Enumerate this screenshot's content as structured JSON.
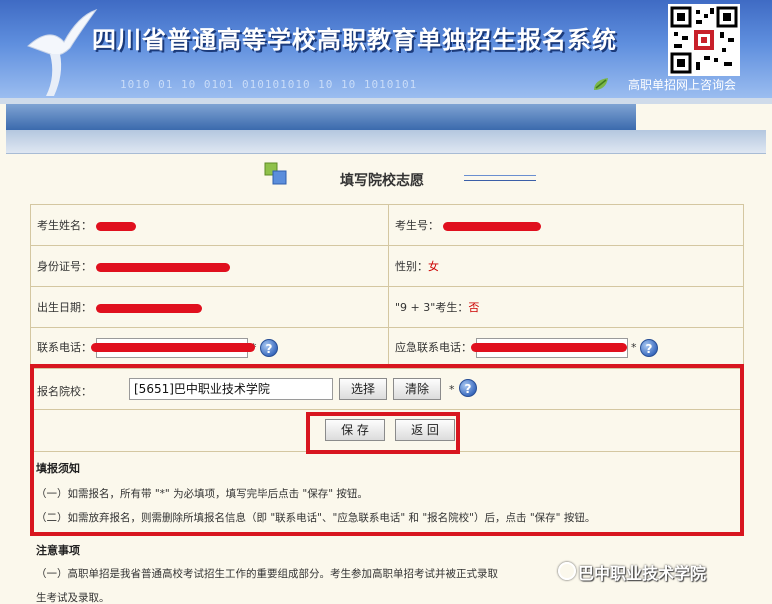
{
  "banner": {
    "title": "四川省普通高等学校高职教育单独招生报名系统",
    "subtitle": "高职单招网上咨询会",
    "binary": "1010 01 10 0101 010101010 10 10 1010101",
    "colors": {
      "top": "#3f6bc4",
      "bottom": "#9bbdf0"
    }
  },
  "page": {
    "heading": "填写院校志愿"
  },
  "form": {
    "name_label": "考生姓名：",
    "exam_no_label": "考生号：",
    "id_label": "身份证号：",
    "gender_label": "性别：",
    "gender_value": "女",
    "dob_label": "出生日期：",
    "nine_three_label": "\"9 + 3\"考生：",
    "nine_three_value": "否",
    "phone_label": "联系电话：",
    "phone_required": "*",
    "emergency_label": "应急联系电话：",
    "emergency_required": "*",
    "school_label": "报名院校：",
    "school_value": "[5651]巴中职业技术学院",
    "select_button": "选择",
    "clear_button": "清除",
    "school_required": "*",
    "help_glyph": "?"
  },
  "actions": {
    "save": "保 存",
    "back": "返 回"
  },
  "notes": {
    "title": "填报须知",
    "items": [
      "（一）如需报名，所有带 \"*\" 为必填项，填写完毕后点击 \"保存\" 按钮。",
      "（二）如需放弃报名，则需删除所填报名信息（即 \"联系电话\"、\"应急联系电话\" 和 \"报名院校\"）后，点击 \"保存\" 按钮。"
    ]
  },
  "caution": {
    "title": "注意事项",
    "items": [
      "（一）高职单招是我省普通高校考试招生工作的重要组成部分。考生参加高职单招考试并被正式录取",
      "生考试及录取。"
    ]
  },
  "watermark": "巴中职业技术学院",
  "highlight_color": "#d8161f"
}
